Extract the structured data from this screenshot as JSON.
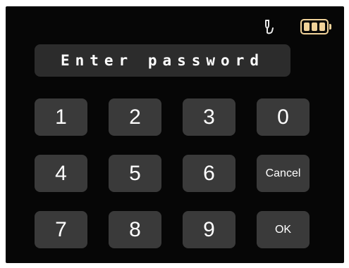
{
  "status_bar": {
    "usb_icon": "usb-plug-icon",
    "battery_icon": "battery-full-icon",
    "battery_color": "#f1d39a"
  },
  "password_prompt": "Enter password",
  "keypad": {
    "key_1": "1",
    "key_2": "2",
    "key_3": "3",
    "key_0": "0",
    "key_4": "4",
    "key_5": "5",
    "key_6": "6",
    "key_cancel": "Cancel",
    "key_7": "7",
    "key_8": "8",
    "key_9": "9",
    "key_ok": "OK"
  },
  "colors": {
    "background": "#060606",
    "key": "#3a3a3a",
    "field": "#2c2c2c",
    "text": "#ffffff"
  }
}
